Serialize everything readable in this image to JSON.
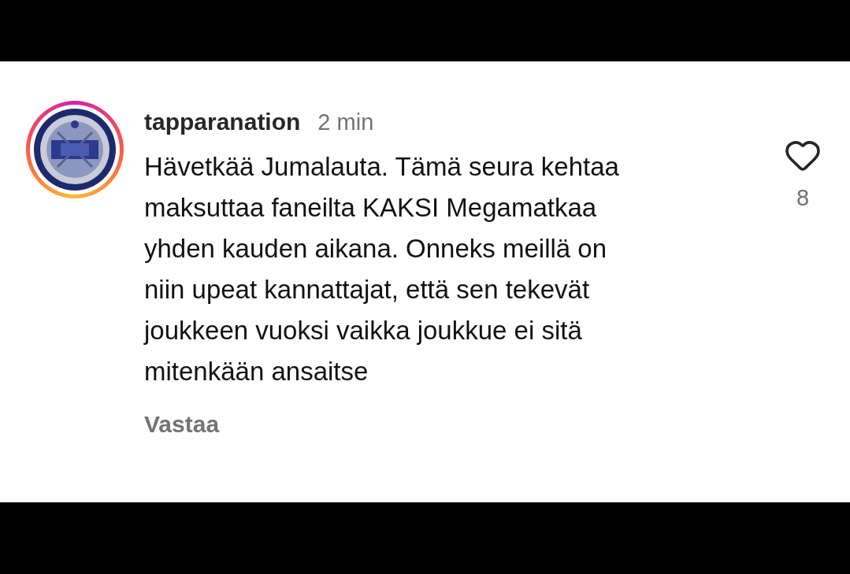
{
  "comment": {
    "username": "tapparanation",
    "time": "2 min",
    "text": "Hävetkää Jumalauta. Tämä seura kehtaa maksuttaa faneilta KAKSI Megamatkaa yhden kauden aikana. Onneks meillä on niin upeat kannattajat, että sen tekevät joukkeen vuoksi vaikka joukkue ei sitä mitenkään ansaitse",
    "reply": "Vastaa",
    "likes": "8",
    "liked": false,
    "avatar": {
      "kind": "picture",
      "story_ring": true
    }
  }
}
